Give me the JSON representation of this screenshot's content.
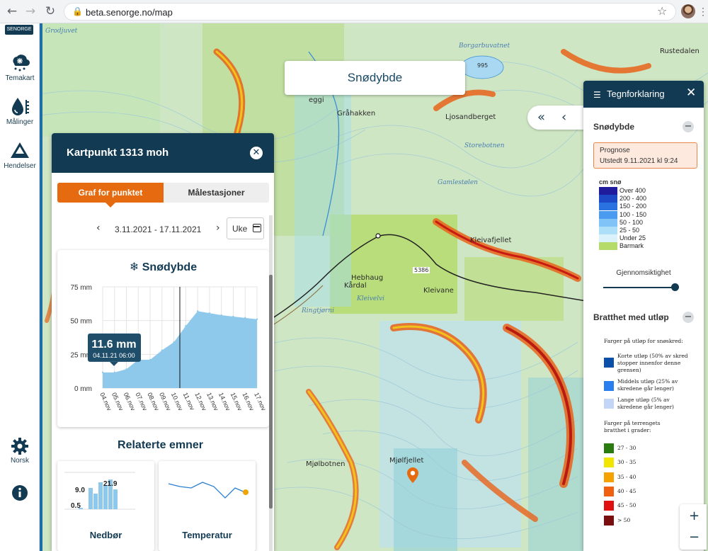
{
  "browser": {
    "url": "beta.senorge.no/map"
  },
  "rail": {
    "logo": "SENORGE",
    "items": [
      {
        "label": "Temakart",
        "icon": "cloud-snow-icon"
      },
      {
        "label": "Målinger",
        "icon": "drop-gauge-icon"
      },
      {
        "label": "Hendelser",
        "icon": "mountain-warning-icon"
      }
    ],
    "settings_label": "Norsk"
  },
  "map": {
    "title": "Snødybde",
    "places": [
      "Grodjuvet",
      "Gråhakken",
      "Ljosandberget",
      "Borgarbuvatnet",
      "Storebotnen",
      "Gamlestølen",
      "Kleivafjellet",
      "Hebhaug",
      "Kårdal",
      "Kleivane",
      "Ringtjørni",
      "Kleivelvi",
      "Mjølfjellet",
      "Mjølbotnen",
      "Rustedalen",
      "eggi",
      "995",
      "5386"
    ]
  },
  "kartpunkt": {
    "title": "Kartpunkt 1313 moh",
    "tabs": [
      "Graf for punktet",
      "Målestasjoner"
    ],
    "date_range": "3.11.2021 - 17.11.2021",
    "period": "Uke",
    "related_title": "Relaterte emner",
    "related": [
      {
        "label": "Nedbør",
        "values": [
          "9.0",
          "0.5",
          "21.9"
        ]
      },
      {
        "label": "Temperatur"
      }
    ]
  },
  "chart_data": {
    "type": "area",
    "title": "Snødybde",
    "x": [
      "04.nov",
      "05.nov",
      "06.nov",
      "07.nov",
      "08.nov",
      "09.nov",
      "10.nov",
      "11.nov",
      "12.nov",
      "13.nov",
      "14.nov",
      "15.nov",
      "16.nov",
      "17.nov"
    ],
    "values": [
      11.6,
      11.6,
      14,
      21,
      21,
      28,
      34,
      46,
      57,
      55.5,
      54,
      53,
      52,
      51
    ],
    "yticks": [
      "0 mm",
      "25 mm",
      "50 mm",
      "75 mm"
    ],
    "ylim": [
      0,
      75
    ],
    "yunit": "mm",
    "now_index": 6.5,
    "tooltip": {
      "value": "11.6 mm",
      "date": "04.11.21 06:00"
    },
    "color": "#8ec9ec",
    "grid": true
  },
  "legend": {
    "title": "Tegnforklaring",
    "snodybde_title": "Snødybde",
    "prognose": "Prognose",
    "utstedt": "Utstedt 9.11.2021 kl 9:24",
    "cm_title": "cm snø",
    "classes": [
      {
        "label": "Over 400",
        "color": "#1f1b9c"
      },
      {
        "label": "200 - 400",
        "color": "#1d49c7"
      },
      {
        "label": "150 - 200",
        "color": "#2a72e0"
      },
      {
        "label": "100 - 150",
        "color": "#4b9bf0"
      },
      {
        "label": "50 - 100",
        "color": "#7fc3f7"
      },
      {
        "label": "25 - 50",
        "color": "#aedff9"
      },
      {
        "label": "Under 25",
        "color": "#d9f2fc"
      },
      {
        "label": "Barmark",
        "color": "#b5dc6a"
      }
    ],
    "opacity_label": "Gjennomsiktighet",
    "bratthet_title": "Bratthet med utløp",
    "utlop_heading": "Farger på utløp for snøskred:",
    "utlop": [
      {
        "label": "Korte utløp (50% av skred stopper innenfor denne grensen)",
        "color": "#0a4fa8"
      },
      {
        "label": "Middels utløp (25% av skredene går lenger)",
        "color": "#2a7ff0"
      },
      {
        "label": "Lange utløp (5% av skredene går lenger)",
        "color": "#c4d6f7"
      }
    ],
    "steep_heading": "Farger på terrengets bratthet i grader:",
    "steep": [
      {
        "label": "27 - 30",
        "color": "#2a7b10"
      },
      {
        "label": "30 - 35",
        "color": "#f2e600"
      },
      {
        "label": "35 - 40",
        "color": "#f5a200"
      },
      {
        "label": "40 - 45",
        "color": "#f06010"
      },
      {
        "label": "45 - 50",
        "color": "#e01010"
      },
      {
        "label": "> 50",
        "color": "#7a0d0d"
      }
    ]
  }
}
